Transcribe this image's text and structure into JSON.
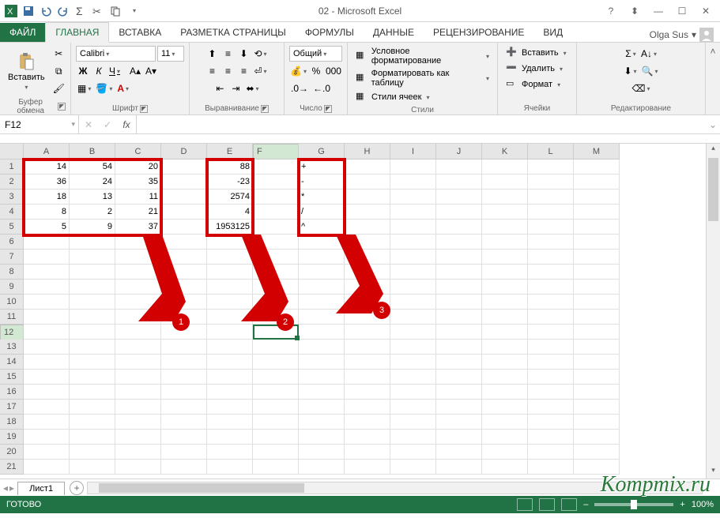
{
  "title": "02 - Microsoft Excel",
  "user": "Olga Sus",
  "tabs": {
    "file": "ФАЙЛ",
    "home": "ГЛАВНАЯ",
    "insert": "ВСТАВКА",
    "layout": "РАЗМЕТКА СТРАНИЦЫ",
    "formulas": "ФОРМУЛЫ",
    "data": "ДАННЫЕ",
    "review": "РЕЦЕНЗИРОВАНИЕ",
    "view": "ВИД"
  },
  "ribbon": {
    "clipboard": {
      "paste": "Вставить",
      "label": "Буфер обмена"
    },
    "font": {
      "name": "Calibri",
      "size": "11",
      "bold": "Ж",
      "italic": "К",
      "underline": "Ч",
      "label": "Шрифт"
    },
    "align": {
      "label": "Выравнивание"
    },
    "number": {
      "format": "Общий",
      "label": "Число"
    },
    "styles": {
      "cond": "Условное форматирование",
      "table": "Форматировать как таблицу",
      "cell": "Стили ячеек",
      "label": "Стили"
    },
    "cells": {
      "insert": "Вставить",
      "delete": "Удалить",
      "format": "Формат",
      "label": "Ячейки"
    },
    "editing": {
      "label": "Редактирование"
    }
  },
  "namebox": "F12",
  "columns": [
    "A",
    "B",
    "C",
    "D",
    "E",
    "F",
    "G",
    "H",
    "I",
    "J",
    "K",
    "L",
    "M"
  ],
  "rows": 21,
  "cells": {
    "r1": {
      "A": "14",
      "B": "54",
      "C": "20",
      "E": "88",
      "G": "+"
    },
    "r2": {
      "A": "36",
      "B": "24",
      "C": "35",
      "E": "-23",
      "G": "-"
    },
    "r3": {
      "A": "18",
      "B": "13",
      "C": "11",
      "E": "2574",
      "G": "*"
    },
    "r4": {
      "A": "8",
      "B": "2",
      "C": "21",
      "E": "4",
      "G": "/"
    },
    "r5": {
      "A": "5",
      "B": "9",
      "C": "37",
      "E": "1953125",
      "G": "^"
    }
  },
  "activeCell": "F12",
  "sheet": "Лист1",
  "status": "ГОТОВО",
  "zoom": "100%",
  "annotations": {
    "a1": "1",
    "a2": "2",
    "a3": "3"
  },
  "watermark": "Kompmix.ru"
}
